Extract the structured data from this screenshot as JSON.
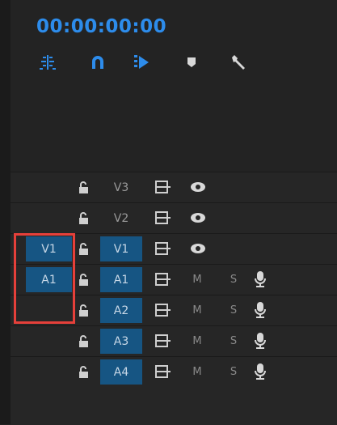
{
  "timecode": "00:00:00:00",
  "tools": [
    {
      "name": "snap-in-timeline-icon"
    },
    {
      "name": "magnet-linked-selection-icon"
    },
    {
      "name": "add-marker-icon"
    },
    {
      "name": "marker-icon"
    },
    {
      "name": "wrench-settings-icon"
    }
  ],
  "video_tracks": [
    {
      "label": "V3",
      "source": "",
      "active": false
    },
    {
      "label": "V2",
      "source": "",
      "active": false
    },
    {
      "label": "V1",
      "source": "V1",
      "active": true
    }
  ],
  "audio_tracks": [
    {
      "label": "A1",
      "source": "A1",
      "mute": "M",
      "solo": "S"
    },
    {
      "label": "A2",
      "source": "",
      "mute": "M",
      "solo": "S"
    },
    {
      "label": "A3",
      "source": "",
      "mute": "M",
      "solo": "S"
    },
    {
      "label": "A4",
      "source": "",
      "mute": "M",
      "solo": "S"
    }
  ],
  "colors": {
    "accent": "#2d8ceb",
    "track_active": "#165583",
    "highlight": "#e5403a",
    "icon": "#d8d8d8"
  }
}
